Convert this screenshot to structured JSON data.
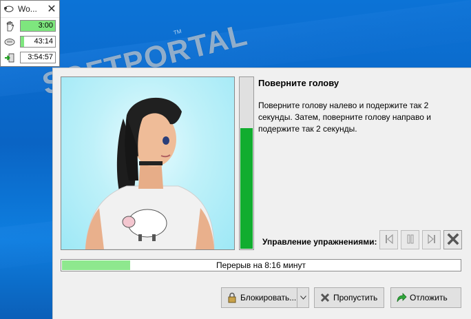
{
  "mini_window": {
    "title": "Wo...",
    "close_glyph": "✕",
    "rows": [
      {
        "icon": "hand-icon",
        "value": "3:00",
        "fill_fraction": 1.0
      },
      {
        "icon": "keyboard-icon",
        "value": "43:14",
        "fill_fraction": 0.1
      },
      {
        "icon": "exit-icon",
        "value": "3:54:57",
        "fill_fraction": 0.0
      }
    ]
  },
  "watermark": {
    "text": "SOFTPORTAL",
    "url": "www.softportal.com",
    "tm": "TM"
  },
  "exercise": {
    "title": "Поверните голову",
    "description": "Поверните голову налево и подержите так 2 секунды. Затем, поверните голову направо и подержите так 2 секунды.",
    "progress_fraction": 0.71
  },
  "controls": {
    "label": "Управление упражнениями:",
    "buttons": [
      "previous-icon",
      "pause-icon",
      "next-icon",
      "stop-icon"
    ]
  },
  "break_bar": {
    "label": "Перерыв на 8:16 минут",
    "progress_fraction": 0.17
  },
  "buttons": {
    "lock": "Блокировать...",
    "skip": "Пропустить",
    "postpone": "Отложить"
  },
  "colors": {
    "desktop": "#0a6fd0",
    "vertical_progress": "#11ad2f",
    "light_progress": "#8ee88e"
  }
}
